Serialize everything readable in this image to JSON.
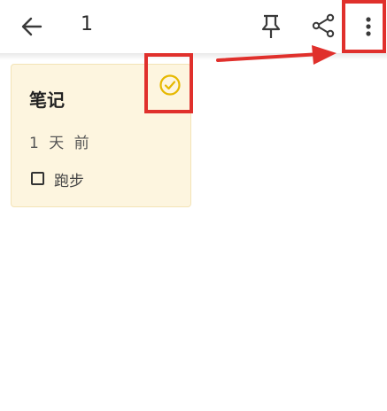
{
  "header": {
    "count": "1"
  },
  "note": {
    "title": "笔记",
    "date": "1 天 前",
    "todo_label": "跑步"
  },
  "colors": {
    "accent_check": "#e6b800",
    "highlight_red": "#e0302c",
    "card_bg": "#fdf5df"
  },
  "icons": [
    "back-arrow-icon",
    "pin-icon",
    "share-icon",
    "more-vertical-icon",
    "check-circle-icon",
    "checkbox-icon"
  ]
}
